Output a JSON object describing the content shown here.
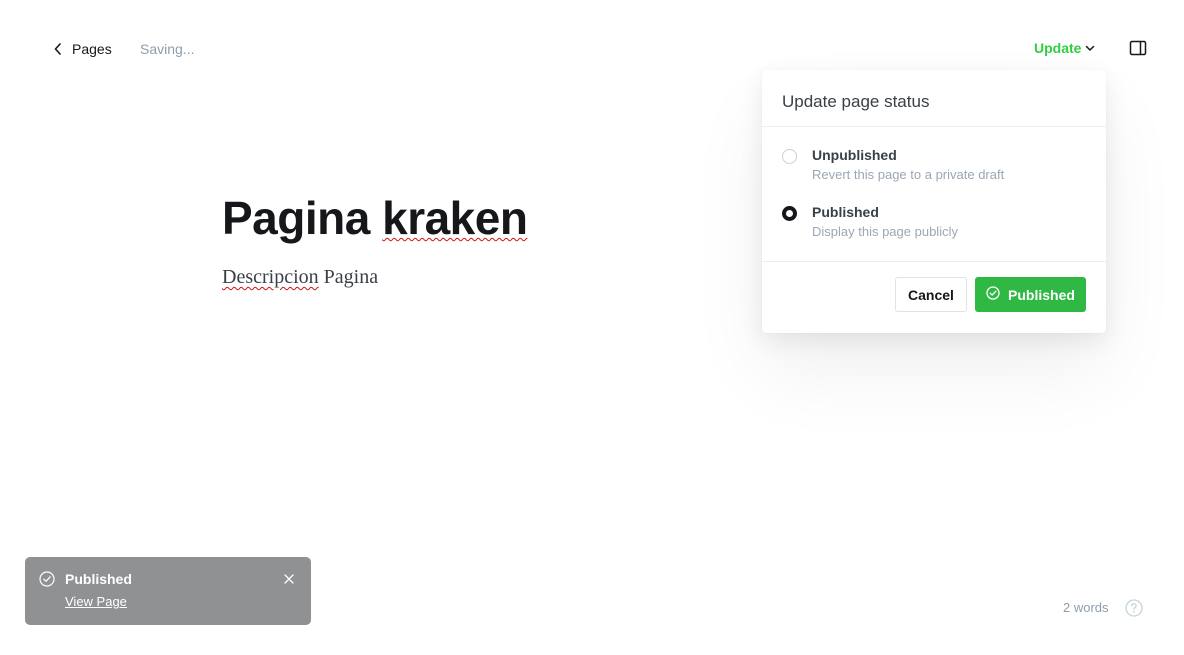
{
  "header": {
    "back_label": "Pages",
    "saving_status": "Saving...",
    "update_label": "Update",
    "accent_color": "#30cf43"
  },
  "editor": {
    "title_part1": "Pagina",
    "title_part2": "kraken",
    "desc_part1": "Descripcion",
    "desc_part2": "Pagina"
  },
  "publish_menu": {
    "heading": "Update page status",
    "options": [
      {
        "label": "Unpublished",
        "description": "Revert this page to a private draft",
        "selected": false
      },
      {
        "label": "Published",
        "description": "Display this page publicly",
        "selected": true
      }
    ],
    "cancel_label": "Cancel",
    "confirm_label": "Published",
    "confirm_color": "#30b844"
  },
  "notification": {
    "title": "Published",
    "link": "View Page",
    "icon": "check-circle-icon"
  },
  "footer": {
    "word_count": "2 words",
    "help_icon": "question-circle-icon"
  }
}
